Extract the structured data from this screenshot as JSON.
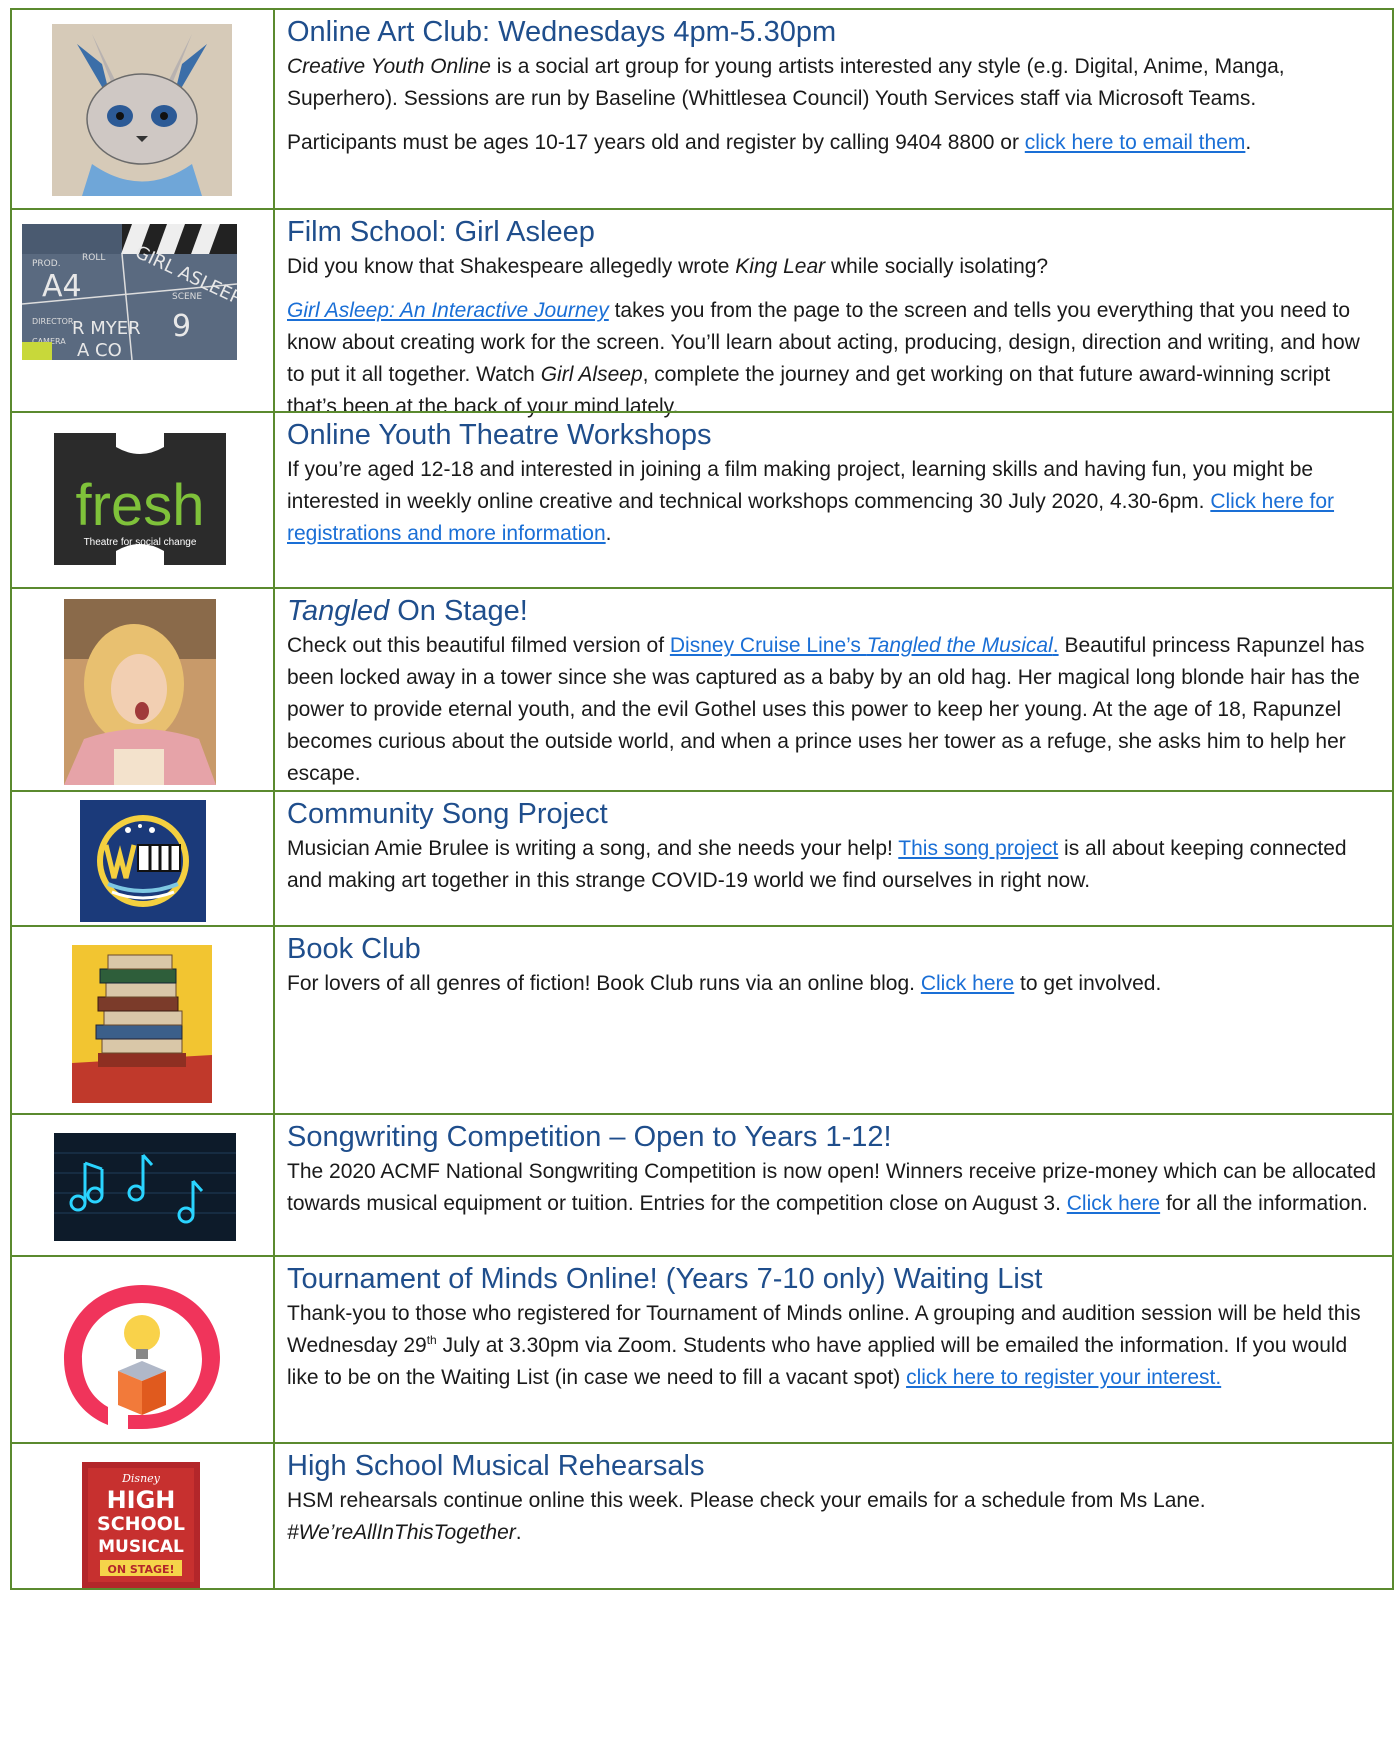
{
  "rows": [
    {
      "title": "Online Art Club: Wednesdays 4pm-5.30pm",
      "p1_em": "Creative Youth Online",
      "p1_rest": " is a social art group for young artists interested any style (e.g. Digital, Anime, Manga, Superhero). Sessions are run by Baseline (Whittlesea Council) Youth Services staff via Microsoft Teams.",
      "p2_pre": "Participants must be ages 10-17 years old and register by calling 9404 8800 or ",
      "p2_link": "click here to email them",
      "p2_post": ".",
      "image": "fox-artwork"
    },
    {
      "title": "Film School: Girl Asleep",
      "p1_pre": "Did you know that Shakespeare allegedly wrote ",
      "p1_em": "King Lear",
      "p1_post": " while socially isolating?",
      "p2_link": "Girl Asleep: An Interactive Journey",
      "p2_mid": " takes you from the page to the screen and tells you everything that you need to know about creating work for the screen.  You’ll learn about acting, producing, design, direction and writing, and how to put it all together. Watch ",
      "p2_em": "Girl Alseep",
      "p2_post": ", complete the journey and get working on that future award-winning script that’s been at the back of your mind lately.",
      "clapper": {
        "roll": "A4",
        "title": "GIRL ASLEEP",
        "scene": "9",
        "director": "R MYER",
        "camera": "A CO",
        "lbl_prod": "PROD.",
        "lbl_roll": "ROLL",
        "lbl_scene": "SCENE",
        "lbl_dir": "DIRECTOR",
        "lbl_cam": "CAMERA"
      }
    },
    {
      "title": "Online Youth Theatre Workshops",
      "p1_pre": "If you’re aged 12-18 and interested in joining a film making project, learning skills and having fun, you might be interested in weekly online creative and technical workshops commencing 30 July 2020, 4.30-6pm. ",
      "p1_link": "Click here for registrations and more information",
      "p1_post": ".",
      "logo": {
        "word": "fresh",
        "tagline": "Theatre for social change"
      }
    },
    {
      "title_em": "Tangled",
      "title_rest": " On Stage!",
      "p1_pre": "Check out this beautiful filmed version of ",
      "p1_link_pre": "Disney Cruise Line’s ",
      "p1_link_em": "Tangled the Musical",
      "p1_link_post": ".",
      "p1_post": " Beautiful princess Rapunzel has been locked away in a tower since she was captured as a baby by an old hag. Her magical long blonde hair has the power to provide eternal youth, and the evil Gothel uses this power to keep her young. At the age of 18, Rapunzel becomes curious about the outside world, and when a prince uses her tower as a refuge, she asks him to help her escape.",
      "image": "rapunzel-photo"
    },
    {
      "title": "Community Song Project",
      "p1_pre": "Musician Amie Brulee is writing a song, and she needs your help! ",
      "p1_link": "This song project",
      "p1_post": " is all about keeping connected and making art together in this strange COVID-19 world we find ourselves in right now.",
      "image": "song-project-logo"
    },
    {
      "title": "Book Club",
      "p1_pre": "For lovers of all genres of fiction! Book Club runs via an online blog. ",
      "p1_link": "Click here",
      "p1_post": " to get involved.",
      "image": "book-stack"
    },
    {
      "title": "Songwriting Competition – Open to Years 1-12!",
      "p1_pre": "The 2020 ACMF National Songwriting Competition is now open! Winners receive prize-money which can be allocated towards musical equipment or tuition. Entries for the competition close on August 3. ",
      "p1_link": "Click here",
      "p1_post": " for all the information.",
      "image": "neon-music-notes"
    },
    {
      "title": "Tournament of Minds Online! (Years 7-10 only) Waiting List",
      "p1_a": "Thank-you to those who registered for Tournament of Minds online. A grouping and audition session will be held this Wednesday 29",
      "p1_sup": "th",
      "p1_b": " July at 3.30pm via Zoom. Students who have applied will be emailed the information. If you would like to be on the Waiting List (in case we need to fill a vacant spot) ",
      "p1_link": "click here to register your interest.",
      "image": "lightbulb-head-icon"
    },
    {
      "title": "High School Musical Rehearsals",
      "p1": "HSM rehearsals continue online this week. Please check your emails for a schedule from Ms Lane.",
      "p2_em": "#We’reAllInThisTogether",
      "p2_post": ".",
      "poster": {
        "brand": "Disney",
        "l1": "HIGH",
        "l2": "SCHOOL",
        "l3": "MUSICAL",
        "l4": "ON STAGE!"
      }
    }
  ]
}
